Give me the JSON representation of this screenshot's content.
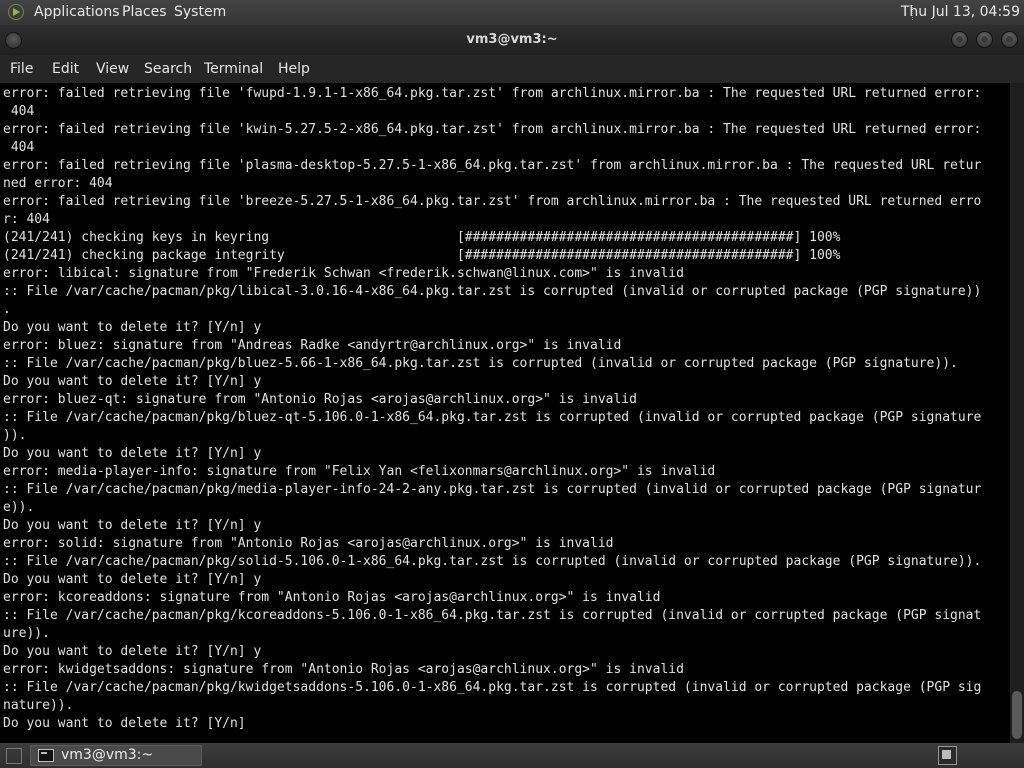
{
  "top_panel": {
    "applications": "Applications",
    "places": "Places",
    "system": "System",
    "clock": "Thu Jul 13, 04:59"
  },
  "window": {
    "title": "vm3@vm3:~"
  },
  "menubar": {
    "file": "File",
    "edit": "Edit",
    "view": "View",
    "search": "Search",
    "terminal": "Terminal",
    "help": "Help"
  },
  "terminal": {
    "text": "error: failed retrieving file 'fwupd-1.9.1-1-x86_64.pkg.tar.zst' from archlinux.mirror.ba : The requested URL returned error:\n 404\nerror: failed retrieving file 'kwin-5.27.5-2-x86_64.pkg.tar.zst' from archlinux.mirror.ba : The requested URL returned error:\n 404\nerror: failed retrieving file 'plasma-desktop-5.27.5-1-x86_64.pkg.tar.zst' from archlinux.mirror.ba : The requested URL retur\nned error: 404\nerror: failed retrieving file 'breeze-5.27.5-1-x86_64.pkg.tar.zst' from archlinux.mirror.ba : The requested URL returned erro\nr: 404\n(241/241) checking keys in keyring                        [##########################################] 100%\n(241/241) checking package integrity                      [##########################################] 100%\nerror: libical: signature from \"Frederik Schwan <frederik.schwan@linux.com>\" is invalid\n:: File /var/cache/pacman/pkg/libical-3.0.16-4-x86_64.pkg.tar.zst is corrupted (invalid or corrupted package (PGP signature))\n.\nDo you want to delete it? [Y/n] y\nerror: bluez: signature from \"Andreas Radke <andyrtr@archlinux.org>\" is invalid\n:: File /var/cache/pacman/pkg/bluez-5.66-1-x86_64.pkg.tar.zst is corrupted (invalid or corrupted package (PGP signature)).\nDo you want to delete it? [Y/n] y\nerror: bluez-qt: signature from \"Antonio Rojas <arojas@archlinux.org>\" is invalid\n:: File /var/cache/pacman/pkg/bluez-qt-5.106.0-1-x86_64.pkg.tar.zst is corrupted (invalid or corrupted package (PGP signature\n)).\nDo you want to delete it? [Y/n] y\nerror: media-player-info: signature from \"Felix Yan <felixonmars@archlinux.org>\" is invalid\n:: File /var/cache/pacman/pkg/media-player-info-24-2-any.pkg.tar.zst is corrupted (invalid or corrupted package (PGP signatur\ne)).\nDo you want to delete it? [Y/n] y\nerror: solid: signature from \"Antonio Rojas <arojas@archlinux.org>\" is invalid\n:: File /var/cache/pacman/pkg/solid-5.106.0-1-x86_64.pkg.tar.zst is corrupted (invalid or corrupted package (PGP signature)).\nDo you want to delete it? [Y/n] y\nerror: kcoreaddons: signature from \"Antonio Rojas <arojas@archlinux.org>\" is invalid\n:: File /var/cache/pacman/pkg/kcoreaddons-5.106.0-1-x86_64.pkg.tar.zst is corrupted (invalid or corrupted package (PGP signat\nure)).\nDo you want to delete it? [Y/n] y\nerror: kwidgetsaddons: signature from \"Antonio Rojas <arojas@archlinux.org>\" is invalid\n:: File /var/cache/pacman/pkg/kwidgetsaddons-5.106.0-1-x86_64.pkg.tar.zst is corrupted (invalid or corrupted package (PGP sig\nnature)).\nDo you want to delete it? [Y/n]"
  },
  "taskbar": {
    "window_label": "vm3@vm3:~"
  },
  "icons": {
    "main_menu": "gnome-foot-icon",
    "terminal": "terminal-icon",
    "workspace": "workspace-switcher-icon"
  },
  "colors": {
    "terminal_bg": "#000000",
    "terminal_fg": "#e0e0e0",
    "panel_bg": "#3a3a3a"
  }
}
